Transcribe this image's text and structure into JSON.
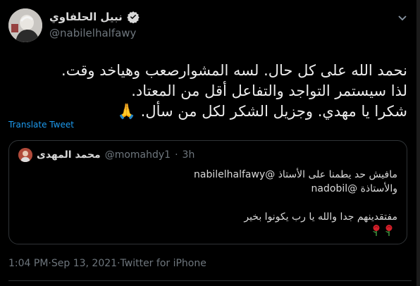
{
  "author": {
    "display_name": "نبيل الحلفاوي",
    "handle": "@nabilelhalfawy",
    "verified": true,
    "avatar_icon": "user-avatar"
  },
  "tweet": {
    "lines": [
      "نحمد الله على كل حال. لسه المشوارصعب وهياخد وقت.",
      "لذا سيستمر التواجد والتفاعل أقل من المعتاد.",
      "شكرا يا مهدي. وجزيل الشكر لكل من سأل. 🙏"
    ],
    "translate_label": "Translate Tweet"
  },
  "quoted": {
    "display_name": "محمد المهدى",
    "handle": "@momahdy1",
    "separator": " · ",
    "age": "3h",
    "line1_prefix": "مافيش حد يطمنا على الأستاذ ",
    "line1_mention": "@nabilelhalfawy",
    "line2_prefix": "والأستاذة ",
    "line2_mention": "@nadobil",
    "line3": "",
    "line4": "مفتقدينهم جدا والله يا رب يكونوا بخير",
    "emoji": [
      "rose-icon",
      "rose-icon"
    ]
  },
  "footer": {
    "time": "1:04 PM",
    "dot1": " · ",
    "date": "Sep 13, 2021",
    "dot2": " · ",
    "client": "Twitter for iPhone"
  },
  "colors": {
    "background": "#000000",
    "link": "#1d9bf0",
    "muted": "#6e767d",
    "border": "#2f3336"
  }
}
